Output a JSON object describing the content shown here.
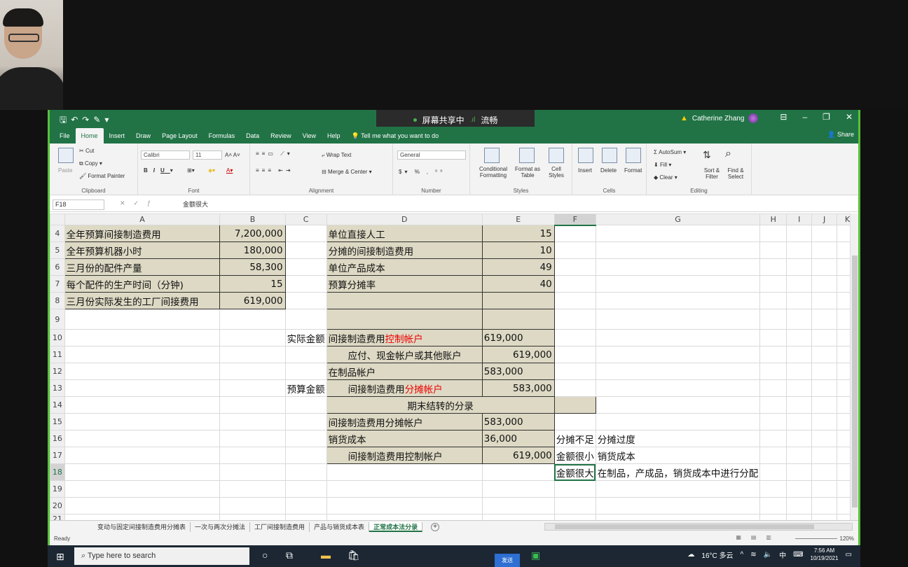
{
  "window": {
    "user": "Catherine Zhang",
    "share_banner": "屏幕共享中",
    "share_quality": "流畅"
  },
  "menu": {
    "tabs": [
      "File",
      "Home",
      "Insert",
      "Draw",
      "Page Layout",
      "Formulas",
      "Data",
      "Review",
      "View",
      "Help"
    ],
    "active": "Home",
    "tell_me": "Tell me what you want to do",
    "share": "Share"
  },
  "ribbon": {
    "clipboard": {
      "paste": "Paste",
      "cut": "Cut",
      "copy": "Copy",
      "format_painter": "Format Painter",
      "label": "Clipboard"
    },
    "font": {
      "name": "Calibri",
      "size": "11",
      "label": "Font"
    },
    "alignment": {
      "wrap": "Wrap Text",
      "merge": "Merge & Center",
      "label": "Alignment"
    },
    "number": {
      "format": "General",
      "label": "Number"
    },
    "styles": {
      "conditional": "Conditional Formatting",
      "format_table": "Format as Table",
      "cell_styles": "Cell Styles",
      "label": "Styles"
    },
    "cells": {
      "insert": "Insert",
      "delete": "Delete",
      "format": "Format",
      "label": "Cells"
    },
    "editing": {
      "autosum": "AutoSum",
      "fill": "Fill",
      "clear": "Clear",
      "sort": "Sort & Filter",
      "find": "Find & Select",
      "label": "Editing"
    }
  },
  "formula_bar": {
    "name_box": "F18",
    "content": "金额很大"
  },
  "columns": [
    "A",
    "B",
    "C",
    "D",
    "E",
    "F",
    "G",
    "H",
    "I",
    "J",
    "K"
  ],
  "rows": [
    {
      "n": "4",
      "a": "全年预算间接制造费用",
      "b": "7,200,000",
      "c": "",
      "d": "单位直接人工",
      "e": "15"
    },
    {
      "n": "5",
      "a": "全年预算机器小时",
      "b": "180,000",
      "c": "",
      "d": "分摊的间接制造费用",
      "e": "10"
    },
    {
      "n": "6",
      "a": "三月份的配件产量",
      "b": "58,300",
      "c": "",
      "d": "单位产品成本",
      "e": "49"
    },
    {
      "n": "7",
      "a": "每个配件的生产时间（分钟)",
      "b": "15",
      "c": "",
      "d": "预算分摊率",
      "e": "40"
    },
    {
      "n": "8",
      "a": "三月份实际发生的工厂间接费用",
      "b": "619,000",
      "c": "",
      "d": "",
      "e": ""
    },
    {
      "n": "9",
      "a": "",
      "b": "",
      "c": "",
      "d": "",
      "e": ""
    },
    {
      "n": "10",
      "a": "",
      "b": "",
      "c": "实际金额",
      "d": "间接制造费用",
      "d_red": "控制帐户",
      "e": "619,000"
    },
    {
      "n": "11",
      "a": "",
      "b": "",
      "c": "",
      "d": "应付、现金帐户或其他账户",
      "e": "619,000"
    },
    {
      "n": "12",
      "a": "",
      "b": "",
      "c": "",
      "d": "在制品帐户",
      "e": "583,000"
    },
    {
      "n": "13",
      "a": "",
      "b": "",
      "c": "预算金额",
      "d": "间接制造费用",
      "d_red": "分摊帐户",
      "e": "583,000"
    },
    {
      "n": "14",
      "a": "",
      "b": "",
      "c": "",
      "d": "期末结转的分录",
      "e": ""
    },
    {
      "n": "15",
      "a": "",
      "b": "",
      "c": "",
      "d": "间接制造费用分摊帐户",
      "e": "583,000"
    },
    {
      "n": "16",
      "a": "",
      "b": "",
      "c": "",
      "d": "销货成本",
      "e": "36,000",
      "f": "分摊不足",
      "g": "分摊过度"
    },
    {
      "n": "17",
      "a": "",
      "b": "",
      "c": "",
      "d": "间接制造费用控制帐户",
      "e": "619,000",
      "f": "金额很小",
      "g": "销货成本"
    },
    {
      "n": "18",
      "a": "",
      "b": "",
      "c": "",
      "d": "",
      "e": "",
      "f": "金额很大",
      "g": "在制品，产成品，销货成本中进行分配"
    },
    {
      "n": "19"
    },
    {
      "n": "20"
    },
    {
      "n": "21"
    }
  ],
  "sheet_tabs": [
    "变动与固定间接制造费用分摊表",
    "一次与两次分摊法",
    "工厂间接制造费用",
    "产品与销货成本表",
    "正常成本法分录"
  ],
  "active_sheet": "正常成本法分录",
  "status": {
    "ready": "Ready",
    "zoom": "120%"
  },
  "taskbar": {
    "search": "Type here to search",
    "send": "发送",
    "weather": "16°C 多云",
    "ime": "中",
    "time": "7:56 AM",
    "date": "10/19/2021"
  },
  "colors": {
    "excel_green": "#217346",
    "shade": "#ddd9c4",
    "red_text": "#e00000"
  }
}
